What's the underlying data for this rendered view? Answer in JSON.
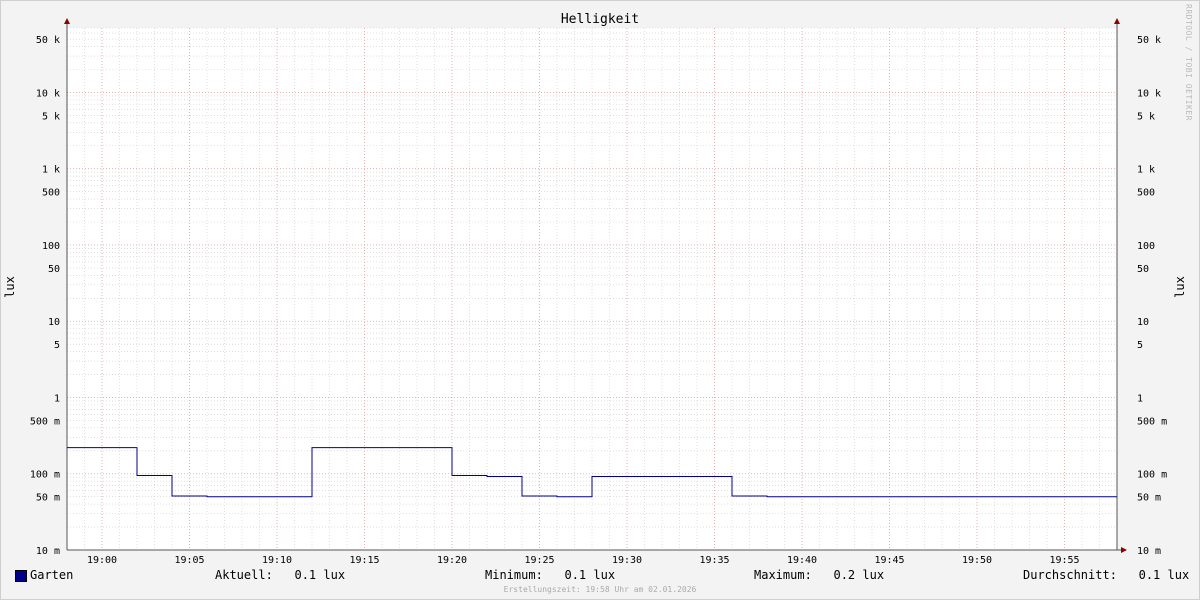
{
  "chart_data": {
    "type": "line",
    "title": "Helligkeit",
    "ylabel_left": "lux",
    "ylabel_right": "lux",
    "yscale": "log",
    "ylim": [
      0.01,
      70000
    ],
    "y_ticks": [
      {
        "value": 50000,
        "label": "50 k"
      },
      {
        "value": 10000,
        "label": "10 k"
      },
      {
        "value": 5000,
        "label": "5 k"
      },
      {
        "value": 1000,
        "label": "1 k"
      },
      {
        "value": 500,
        "label": "500"
      },
      {
        "value": 100,
        "label": "100"
      },
      {
        "value": 50,
        "label": "50"
      },
      {
        "value": 10,
        "label": "10"
      },
      {
        "value": 5,
        "label": "5"
      },
      {
        "value": 1,
        "label": "1"
      },
      {
        "value": 0.5,
        "label": "500 m"
      },
      {
        "value": 0.1,
        "label": "100 m"
      },
      {
        "value": 0.05,
        "label": "50 m"
      },
      {
        "value": 0.01,
        "label": "10 m"
      }
    ],
    "x_range": [
      "18:58",
      "19:58"
    ],
    "x_ticks": [
      "19:00",
      "19:05",
      "19:10",
      "19:15",
      "19:20",
      "19:25",
      "19:30",
      "19:35",
      "19:40",
      "19:45",
      "19:50",
      "19:55"
    ],
    "series": [
      {
        "name": "Garten",
        "color": "#00008b",
        "step": true,
        "points": [
          {
            "t": "18:58",
            "v": 0.22
          },
          {
            "t": "19:02",
            "v": 0.095
          },
          {
            "t": "19:04",
            "v": 0.051
          },
          {
            "t": "19:06",
            "v": 0.05
          },
          {
            "t": "19:12",
            "v": 0.22
          },
          {
            "t": "19:20",
            "v": 0.095
          },
          {
            "t": "19:22",
            "v": 0.092
          },
          {
            "t": "19:24",
            "v": 0.051
          },
          {
            "t": "19:26",
            "v": 0.05
          },
          {
            "t": "19:28",
            "v": 0.092
          },
          {
            "t": "19:36",
            "v": 0.051
          },
          {
            "t": "19:38",
            "v": 0.05
          },
          {
            "t": "19:58",
            "v": 0.05
          }
        ]
      }
    ],
    "legend": {
      "series_name": "Garten",
      "aktuell": "Aktuell:   0.1 lux",
      "minimum": "Minimum:   0.1 lux",
      "maximum": "Maximum:   0.2 lux",
      "durchschnitt": "Durchschnitt:   0.1 lux"
    },
    "footer": "Erstellungszeit: 19:58 Uhr am 02.01.2026",
    "watermark": "RRDTOOL / TOBI OETIKER",
    "colors": {
      "background": "#f3f3f3",
      "canvas": "#ffffff",
      "major_grid": "#e8a6a6",
      "minor_grid": "#cccccc",
      "axis": "#555555",
      "arrow": "#8b0000"
    }
  }
}
